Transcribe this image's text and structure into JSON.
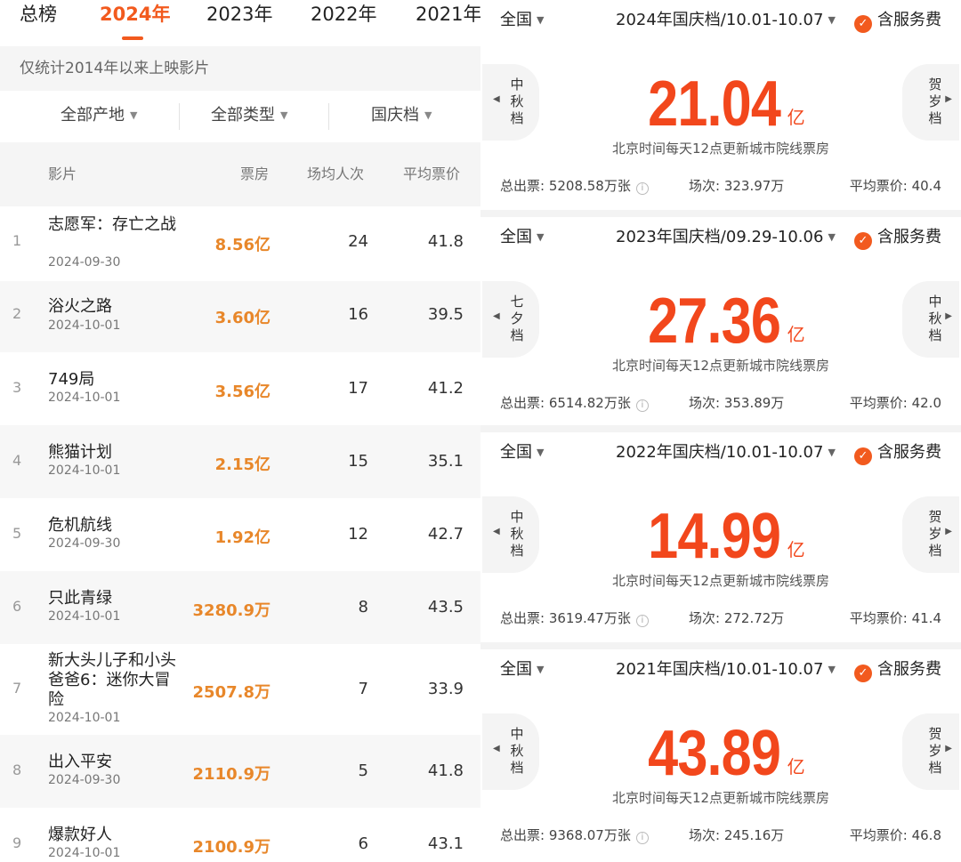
{
  "year_tabs": [
    {
      "label": "总榜"
    },
    {
      "label": "2024年",
      "active": true
    },
    {
      "label": "2023年"
    },
    {
      "label": "2022年"
    },
    {
      "label": "2021年"
    }
  ],
  "note": "仅统计2014年以来上映影片",
  "filters": [
    {
      "label": "全部产地"
    },
    {
      "label": "全部类型"
    },
    {
      "label": "国庆档"
    }
  ],
  "table": {
    "headers": {
      "film": "影片",
      "box": "票房",
      "avg_people": "场均人次",
      "avg_price": "平均票价"
    },
    "rows": [
      {
        "rank": "1",
        "title": "志愿军：存亡之战",
        "date": "2024-09-30",
        "box": "8.56亿",
        "avg_people": "24",
        "avg_price": "41.8"
      },
      {
        "rank": "2",
        "title": "浴火之路",
        "date": "2024-10-01",
        "box": "3.60亿",
        "avg_people": "16",
        "avg_price": "39.5"
      },
      {
        "rank": "3",
        "title": "749局",
        "date": "2024-10-01",
        "box": "3.56亿",
        "avg_people": "17",
        "avg_price": "41.2"
      },
      {
        "rank": "4",
        "title": "熊猫计划",
        "date": "2024-10-01",
        "box": "2.15亿",
        "avg_people": "15",
        "avg_price": "35.1"
      },
      {
        "rank": "5",
        "title": "危机航线",
        "date": "2024-09-30",
        "box": "1.92亿",
        "avg_people": "12",
        "avg_price": "42.7"
      },
      {
        "rank": "6",
        "title": "只此青绿",
        "date": "2024-10-01",
        "box": "3280.9万",
        "avg_people": "8",
        "avg_price": "43.5"
      },
      {
        "rank": "7",
        "title": "新大头儿子和小头爸爸6：迷你大冒险",
        "date": "2024-10-01",
        "box": "2507.8万",
        "avg_people": "7",
        "avg_price": "33.9"
      },
      {
        "rank": "8",
        "title": "出入平安",
        "date": "2024-09-30",
        "box": "2110.9万",
        "avg_people": "5",
        "avg_price": "41.8"
      },
      {
        "rank": "9",
        "title": "爆款好人",
        "date": "2024-10-01",
        "box": "2100.9万",
        "avg_people": "6",
        "avg_price": "43.1"
      }
    ]
  },
  "cards": [
    {
      "region": "全国",
      "period": "2024年国庆档/10.01-10.07",
      "service": "含服务费",
      "left_btn": "中秋档",
      "right_btn": "贺岁档",
      "total": "21.04",
      "unit": "亿",
      "update": "北京时间每天12点更新城市院线票房",
      "tickets": "总出票: 5208.58万张",
      "shows": "场次: 323.97万",
      "avg_price": "平均票价: 40.4"
    },
    {
      "region": "全国",
      "period": "2023年国庆档/09.29-10.06",
      "service": "含服务费",
      "left_btn": "七夕档",
      "right_btn": "中秋档",
      "total": "27.36",
      "unit": "亿",
      "update": "北京时间每天12点更新城市院线票房",
      "tickets": "总出票: 6514.82万张",
      "shows": "场次: 353.89万",
      "avg_price": "平均票价: 42.0"
    },
    {
      "region": "全国",
      "period": "2022年国庆档/10.01-10.07",
      "service": "含服务费",
      "left_btn": "中秋档",
      "right_btn": "贺岁档",
      "total": "14.99",
      "unit": "亿",
      "update": "北京时间每天12点更新城市院线票房",
      "tickets": "总出票: 3619.47万张",
      "shows": "场次: 272.72万",
      "avg_price": "平均票价: 41.4"
    },
    {
      "region": "全国",
      "period": "2021年国庆档/10.01-10.07",
      "service": "含服务费",
      "left_btn": "中秋档",
      "right_btn": "贺岁档",
      "total": "43.89",
      "unit": "亿",
      "update": "北京时间每天12点更新城市院线票房",
      "tickets": "总出票: 9368.07万张",
      "shows": "场次: 245.16万",
      "avg_price": "平均票价: 46.8"
    }
  ],
  "colors": {
    "accent": "#f25a1e",
    "box_office": "#e8872a",
    "total": "#f2471c"
  }
}
